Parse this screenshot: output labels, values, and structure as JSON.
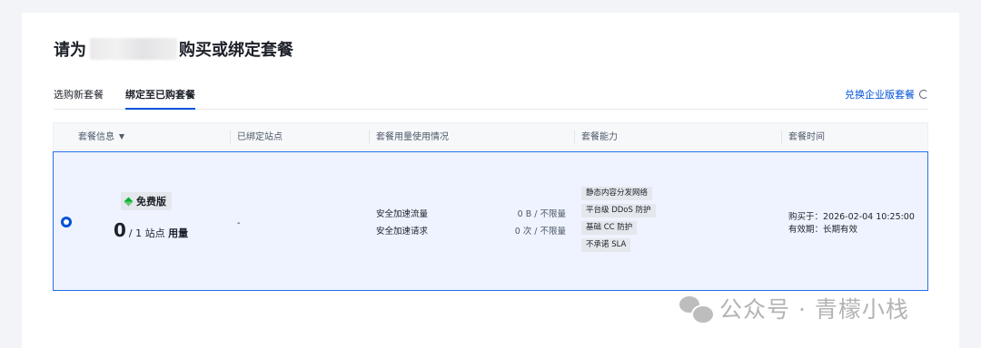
{
  "page": {
    "title_prefix": "请为",
    "title_suffix": "购买或绑定套餐"
  },
  "tabs": {
    "items": [
      {
        "label": "选购新套餐"
      },
      {
        "label": "绑定至已购套餐"
      }
    ],
    "right_link": "兑换企业版套餐",
    "active_index": 1
  },
  "table": {
    "headers": [
      "套餐信息",
      "已绑定站点",
      "套餐用量使用情况",
      "套餐能力",
      "套餐时间"
    ],
    "row": {
      "selected": true,
      "plan_name": "免费版",
      "usage_count": "0",
      "usage_suffix_pre": "/ 1 站点 ",
      "usage_suffix_bold": "用量",
      "bound_sites": "-",
      "metrics": [
        {
          "label": "安全加速流量",
          "value": "0 B / 不限量"
        },
        {
          "label": "安全加速请求",
          "value": "0 次 / 不限量"
        }
      ],
      "capabilities": [
        "静态内容分发网络",
        "平台级 DDoS 防护",
        "基础 CC 防护",
        "不承诺 SLA"
      ],
      "purchase_time": "购买于：2026-02-04 10:25:00",
      "validity": "有效期：长期有效"
    }
  },
  "watermark": {
    "text": "公众号 · 青檬小栈",
    "icon": "wechat-icon"
  },
  "colors": {
    "accent": "#0052d9",
    "row_selected_bg": "#eef3ff",
    "row_selected_border": "#266fe8",
    "tag_bg": "#e4e7ec"
  }
}
